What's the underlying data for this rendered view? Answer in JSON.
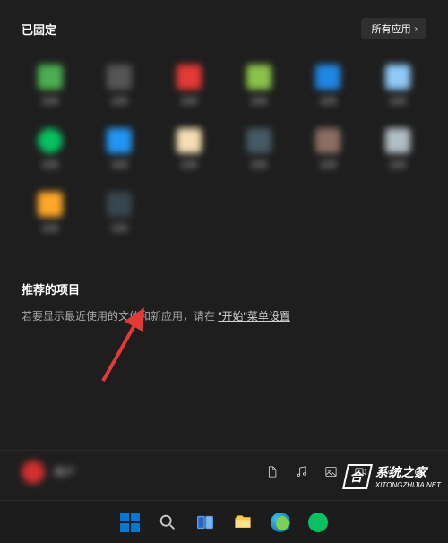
{
  "pinned": {
    "title": "已固定",
    "all_apps_label": "所有应用",
    "apps": [
      {
        "label": "应用"
      },
      {
        "label": "应用"
      },
      {
        "label": "应用"
      },
      {
        "label": "应用"
      },
      {
        "label": "应用"
      },
      {
        "label": "应用"
      },
      {
        "label": "应用"
      },
      {
        "label": "应用"
      },
      {
        "label": "应用"
      },
      {
        "label": "应用"
      },
      {
        "label": "应用"
      },
      {
        "label": "应用"
      },
      {
        "label": "应用"
      },
      {
        "label": "应用"
      }
    ]
  },
  "recommended": {
    "title": "推荐的项目",
    "hint_prefix": "若要显示最近使用的文件和新应用，请在",
    "hint_link": "\"开始\"菜单设置"
  },
  "footer": {
    "username": "用户",
    "icons": {
      "documents": "documents-icon",
      "music": "music-icon",
      "pictures": "pictures-icon",
      "videos": "videos-icon",
      "settings": "settings-icon",
      "power": "power-icon"
    }
  },
  "taskbar": {
    "items": [
      "start",
      "search",
      "taskview",
      "explorer",
      "edge",
      "wechat"
    ]
  },
  "watermark": {
    "text": "系统之家",
    "url": "XITONGZHIJIA.NET"
  }
}
